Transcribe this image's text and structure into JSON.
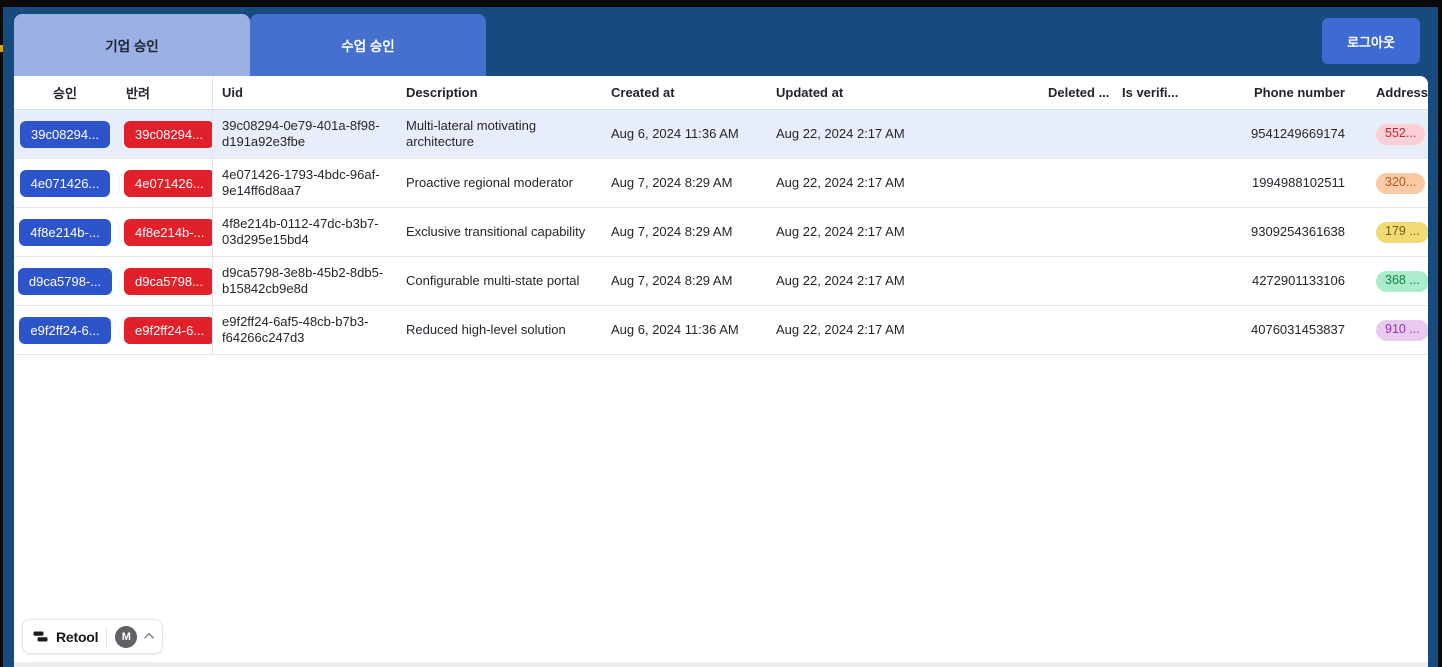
{
  "tabs": [
    {
      "label": "기업 승인",
      "active": true
    },
    {
      "label": "수업 승인",
      "active": false
    }
  ],
  "logout_label": "로그아웃",
  "colors": {
    "canvas_navy": "#164b80",
    "tab_active_bg": "#9bb0e3",
    "tab_inactive_bg": "#4570cd",
    "logout_bg": "#3e6ad3",
    "approve_blue": "#2e54cc",
    "reject_red": "#e1202a",
    "selected_row_bg": "#e8eef9"
  },
  "table": {
    "columns": [
      "승인",
      "반려",
      "Uid",
      "Description",
      "Created at",
      "Updated at",
      "Deleted ...",
      "Is verifi...",
      "Phone number",
      "Address"
    ],
    "rows": [
      {
        "approve_label": "39c08294...",
        "reject_label": "39c08294...",
        "uid": "39c08294-0e79-401a-8f98-d191a92e3fbe",
        "description": "Multi-lateral motivating architecture",
        "created_at": "Aug 6, 2024 11:36 AM",
        "updated_at": "Aug 22, 2024 2:17 AM",
        "deleted_at": "",
        "is_verified": "",
        "phone": "9541249669174",
        "address": {
          "label": "552...",
          "bg": "#fbd0d5",
          "fg": "#c22535"
        },
        "selected": true
      },
      {
        "approve_label": "4e071426...",
        "reject_label": "4e071426...",
        "uid": "4e071426-1793-4bdc-96af-9e14ff6d8aa7",
        "description": "Proactive regional moderator",
        "created_at": "Aug 7, 2024 8:29 AM",
        "updated_at": "Aug 22, 2024 2:17 AM",
        "deleted_at": "",
        "is_verified": "",
        "phone": "1994988102511",
        "address": {
          "label": "320...",
          "bg": "#fbcaa4",
          "fg": "#a9591a"
        },
        "selected": false
      },
      {
        "approve_label": "4f8e214b-...",
        "reject_label": "4f8e214b-...",
        "uid": "4f8e214b-0112-47dc-b3b7-03d295e15bd4",
        "description": "Exclusive transitional capability",
        "created_at": "Aug 7, 2024 8:29 AM",
        "updated_at": "Aug 22, 2024 2:17 AM",
        "deleted_at": "",
        "is_verified": "",
        "phone": "9309254361638",
        "address": {
          "label": "179 ...",
          "bg": "#f3da74",
          "fg": "#6e5e16"
        },
        "selected": false
      },
      {
        "approve_label": "d9ca5798-...",
        "reject_label": "d9ca5798...",
        "uid": "d9ca5798-3e8b-45b2-8db5-b15842cb9e8d",
        "description": "Configurable multi-state portal",
        "created_at": "Aug 7, 2024 8:29 AM",
        "updated_at": "Aug 22, 2024 2:17 AM",
        "deleted_at": "",
        "is_verified": "",
        "phone": "4272901133106",
        "address": {
          "label": "368 ...",
          "bg": "#a9edca",
          "fg": "#1d7c4c"
        },
        "selected": false
      },
      {
        "approve_label": "e9f2ff24-6...",
        "reject_label": "e9f2ff24-6...",
        "uid": "e9f2ff24-6af5-48cb-b7b3-f64266c247d3",
        "description": "Reduced high-level solution",
        "created_at": "Aug 6, 2024 11:36 AM",
        "updated_at": "Aug 22, 2024 2:17 AM",
        "deleted_at": "",
        "is_verified": "",
        "phone": "4076031453837",
        "address": {
          "label": "910 ...",
          "bg": "#ebcaf0",
          "fg": "#9135b3"
        },
        "selected": false
      }
    ]
  },
  "retool_badge": {
    "brand": "Retool",
    "avatar_initial": "M"
  }
}
